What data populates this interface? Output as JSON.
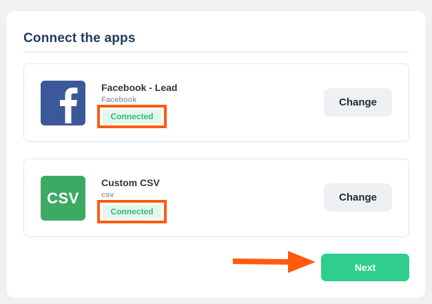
{
  "section": {
    "title": "Connect the apps"
  },
  "apps": [
    {
      "name": "Facebook - Lead",
      "subtitle": "Facebook",
      "status": "Connected",
      "logo_icon": "facebook-logo-icon",
      "change_label": "Change"
    },
    {
      "name": "Custom CSV",
      "subtitle": "csv",
      "logo_text": "CSV",
      "status": "Connected",
      "logo_icon": "csv-logo-icon",
      "change_label": "Change"
    }
  ],
  "footer": {
    "next_label": "Next"
  },
  "colors": {
    "accent": "#2fce8e",
    "title": "#1f3a5c",
    "highlight": "#ff5a0f",
    "facebook": "#3b5998",
    "csv": "#3daa64"
  }
}
